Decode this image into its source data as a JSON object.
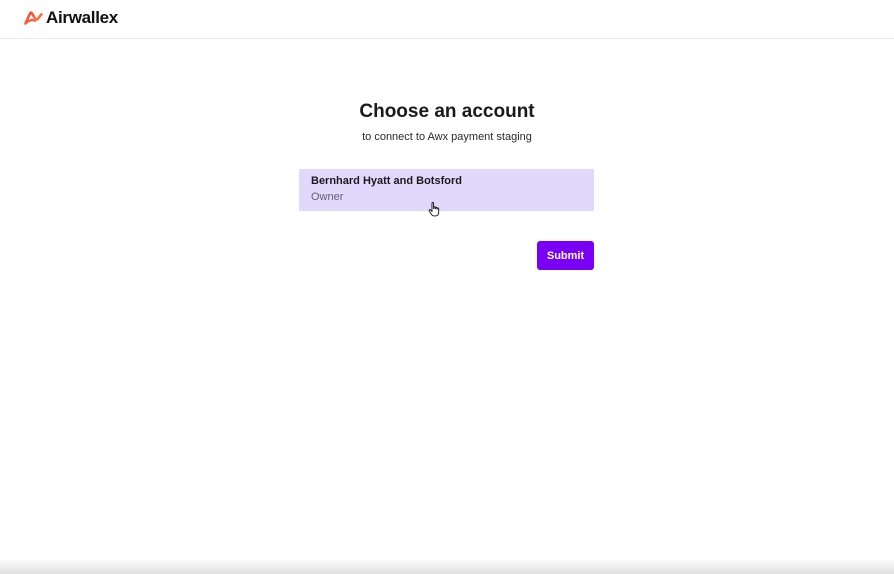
{
  "header": {
    "logo_text": "Airwallex",
    "logo_icon": "airwallex-logo-icon"
  },
  "main": {
    "title": "Choose an account",
    "subtitle": "to connect to Awx payment staging",
    "accounts": [
      {
        "name": "Bernhard Hyatt and Botsford",
        "role": "Owner"
      }
    ],
    "submit_label": "Submit"
  },
  "colors": {
    "accent": "#7a00f5",
    "selected_card_bg": "#e0d9fc",
    "logo_gradient_start": "#ff4f2a",
    "logo_gradient_end": "#ff8a3d"
  },
  "cursor_icon": "hand-pointer-icon"
}
